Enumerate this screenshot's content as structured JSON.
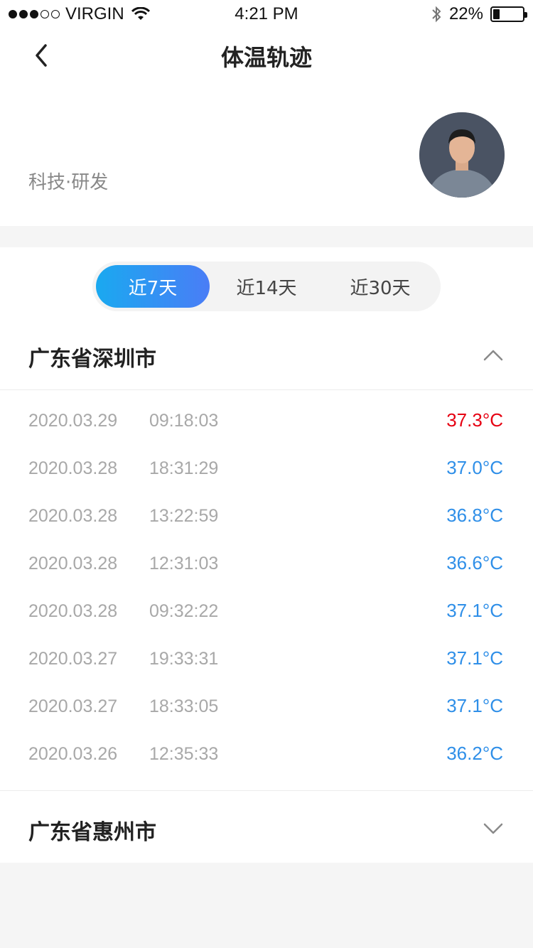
{
  "status_bar": {
    "carrier": "VIRGIN",
    "time": "4:21 PM",
    "battery": "22%",
    "battery_level": 0.22,
    "icons": [
      "signal-dots-icon",
      "wifi-icon",
      "bluetooth-icon",
      "battery-icon"
    ]
  },
  "nav": {
    "title": "体温轨迹",
    "back_icon": "chevron-left-icon"
  },
  "profile": {
    "name": "",
    "dept": "科技·研发",
    "avatar_icon": "avatar"
  },
  "tabs": [
    {
      "label": "近7天",
      "active": true
    },
    {
      "label": "近14天",
      "active": false
    },
    {
      "label": "近30天",
      "active": false
    }
  ],
  "groups": [
    {
      "title": "广东省深圳市",
      "expanded": true,
      "chevron_icon": "chevron-up-icon",
      "records": [
        {
          "date": "2020.03.29",
          "time": "09:18:03",
          "temp": "37.3°C",
          "status": "high"
        },
        {
          "date": "2020.03.28",
          "time": "18:31:29",
          "temp": "37.0°C",
          "status": "normal"
        },
        {
          "date": "2020.03.28",
          "time": "13:22:59",
          "temp": "36.8°C",
          "status": "normal"
        },
        {
          "date": "2020.03.28",
          "time": "12:31:03",
          "temp": "36.6°C",
          "status": "normal"
        },
        {
          "date": "2020.03.28",
          "time": "09:32:22",
          "temp": "37.1°C",
          "status": "normal"
        },
        {
          "date": "2020.03.27",
          "time": "19:33:31",
          "temp": "37.1°C",
          "status": "normal"
        },
        {
          "date": "2020.03.27",
          "time": "18:33:05",
          "temp": "37.1°C",
          "status": "normal"
        },
        {
          "date": "2020.03.26",
          "time": "12:35:33",
          "temp": "36.2°C",
          "status": "normal"
        }
      ]
    },
    {
      "title": "广东省惠州市",
      "expanded": false,
      "chevron_icon": "chevron-down-icon",
      "records": []
    }
  ],
  "colors": {
    "temp_high": "#e60012",
    "temp_normal": "#2f8fe8",
    "tab_active_start": "#1aa9f0",
    "tab_active_end": "#4a7df6"
  }
}
